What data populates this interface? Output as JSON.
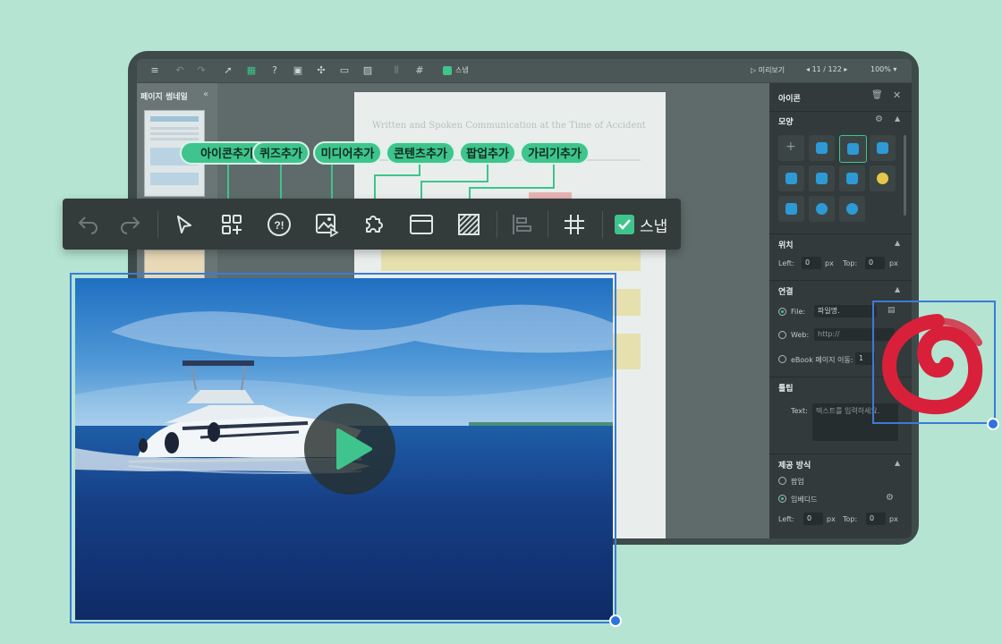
{
  "app_toolbar": {
    "snap_label": "스냅",
    "preview_label": "미리보기",
    "page_indicator": "11 / 122",
    "zoom": "100%"
  },
  "thumbnails": {
    "title": "페이지 썸네일",
    "collapse_glyph": "«"
  },
  "document": {
    "title": "Written and Spoken Communication at the Time of Accident"
  },
  "properties": {
    "panel_title": "아이콘",
    "shape_section": "모양",
    "position_section": "위치",
    "left_label": "Left:",
    "left_value": "0",
    "top_label": "Top:",
    "top_value": "0",
    "unit": "px",
    "link_section": "연결",
    "file_label": "File:",
    "file_value": "파일명.",
    "web_label": "Web:",
    "web_placeholder": "http://",
    "ebook_label": "eBook 페이지 이동:",
    "ebook_value": "1",
    "tooltip_section": "툴팁",
    "text_label": "Text:",
    "text_placeholder": "텍스트를 입력하세요.",
    "provide_section": "제공 방식",
    "popup_label": "팝업",
    "embed_label": "임베디드",
    "bottom_left_value": "0",
    "bottom_top_value": "0"
  },
  "floating_toolbar": {
    "snap_label": "스냅",
    "pills": [
      "아이콘추가",
      "퀴즈추가",
      "미디어추가",
      "콘텐츠추가",
      "팝업추가",
      "가리기추가"
    ]
  },
  "colors": {
    "accent": "#3ec48c",
    "selection": "#3b7bd8",
    "background": "#b5e4d2",
    "brush_icon": "#d8203a"
  }
}
